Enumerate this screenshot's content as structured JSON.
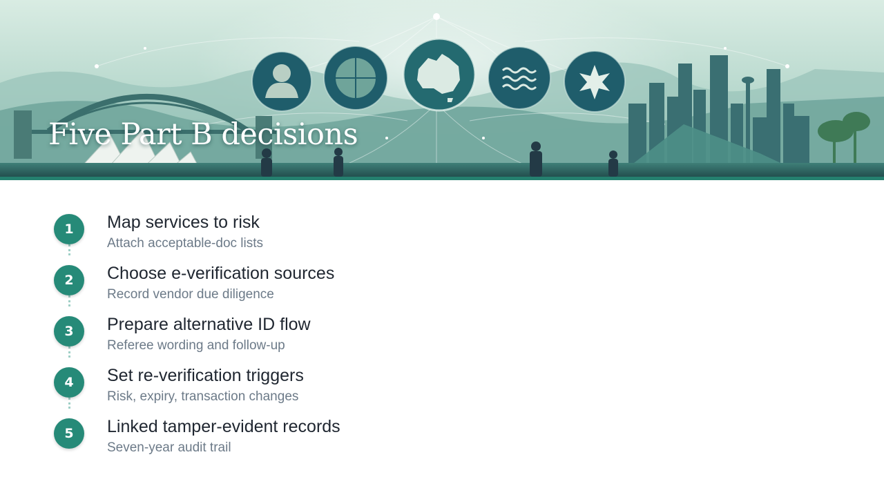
{
  "slide": {
    "title": "Five Part B decisions"
  },
  "steps": [
    {
      "number": "1",
      "title": "Map services to risk",
      "subtitle": "Attach acceptable-doc lists"
    },
    {
      "number": "2",
      "title": "Choose e-verification sources",
      "subtitle": "Record vendor due diligence"
    },
    {
      "number": "3",
      "title": "Prepare alternative ID flow",
      "subtitle": "Referee wording and follow-up"
    },
    {
      "number": "4",
      "title": "Set re-verification triggers",
      "subtitle": "Risk, expiry, transaction changes"
    },
    {
      "number": "5",
      "title": "Linked tamper-evident records",
      "subtitle": "Seven-year audit trail"
    }
  ],
  "colors": {
    "accent": "#268a78",
    "banner_rule": "#24806f",
    "title_text": "#1f2630",
    "subtitle_text": "#6c7a88"
  },
  "banner_icons": [
    "person-icon",
    "globe-icon",
    "australia-map-icon",
    "waves-icon",
    "star-icon"
  ]
}
